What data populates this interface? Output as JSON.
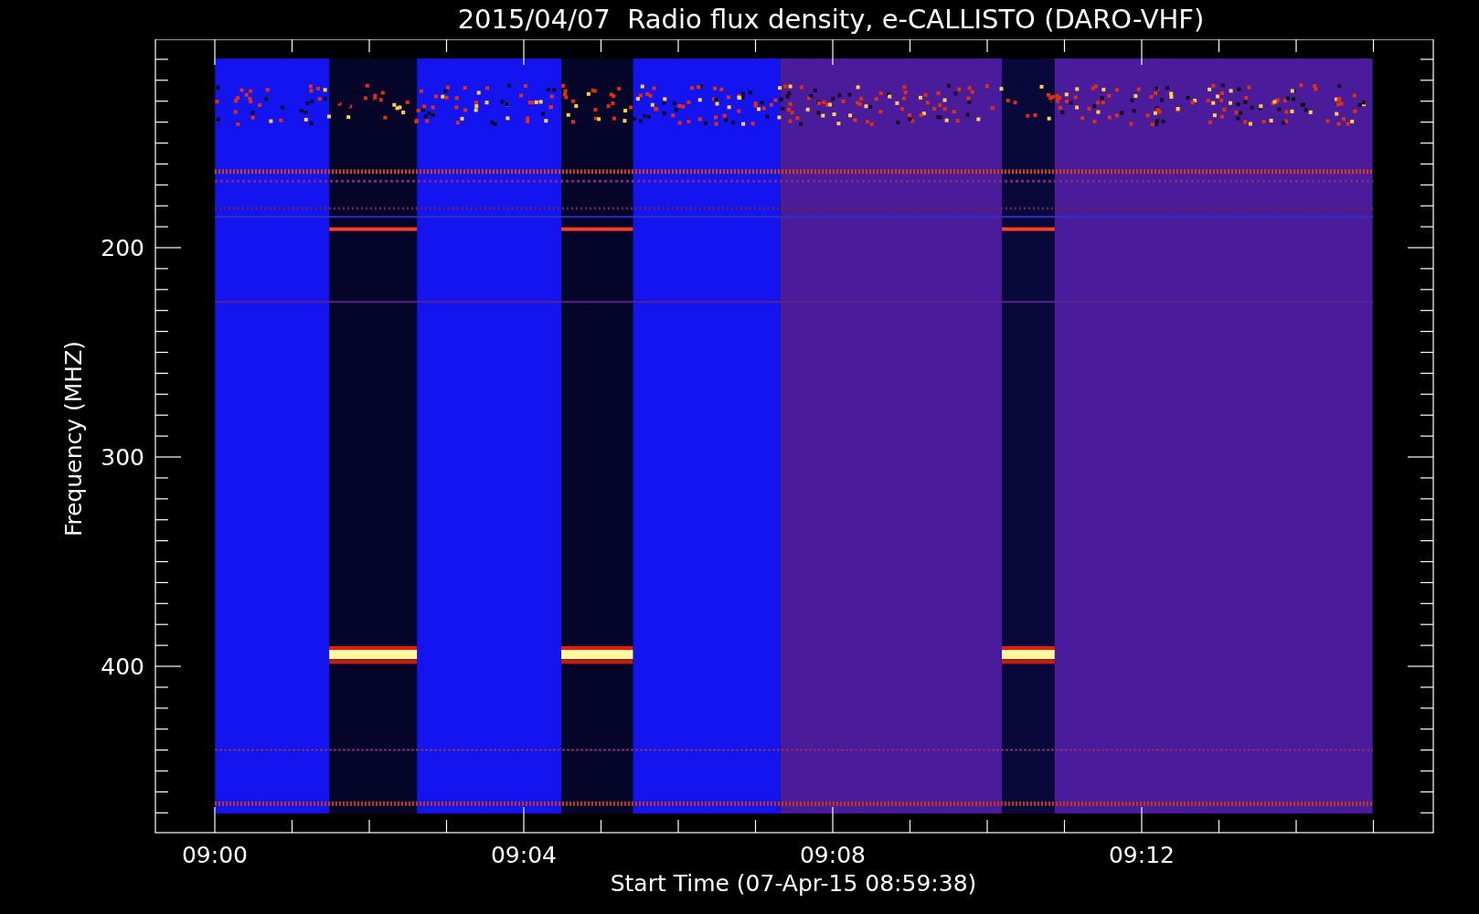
{
  "title": "2015/04/07  Radio flux density, e-CALLISTO (DARO-VHF)",
  "y_axis": {
    "label": "Frequency (MHZ)",
    "ticks": [
      "200",
      "300",
      "400"
    ]
  },
  "x_axis": {
    "label": "Start Time (07-Apr-15 08:59:38)",
    "ticks": [
      "09:00",
      "09:04",
      "09:08",
      "09:12"
    ]
  }
}
